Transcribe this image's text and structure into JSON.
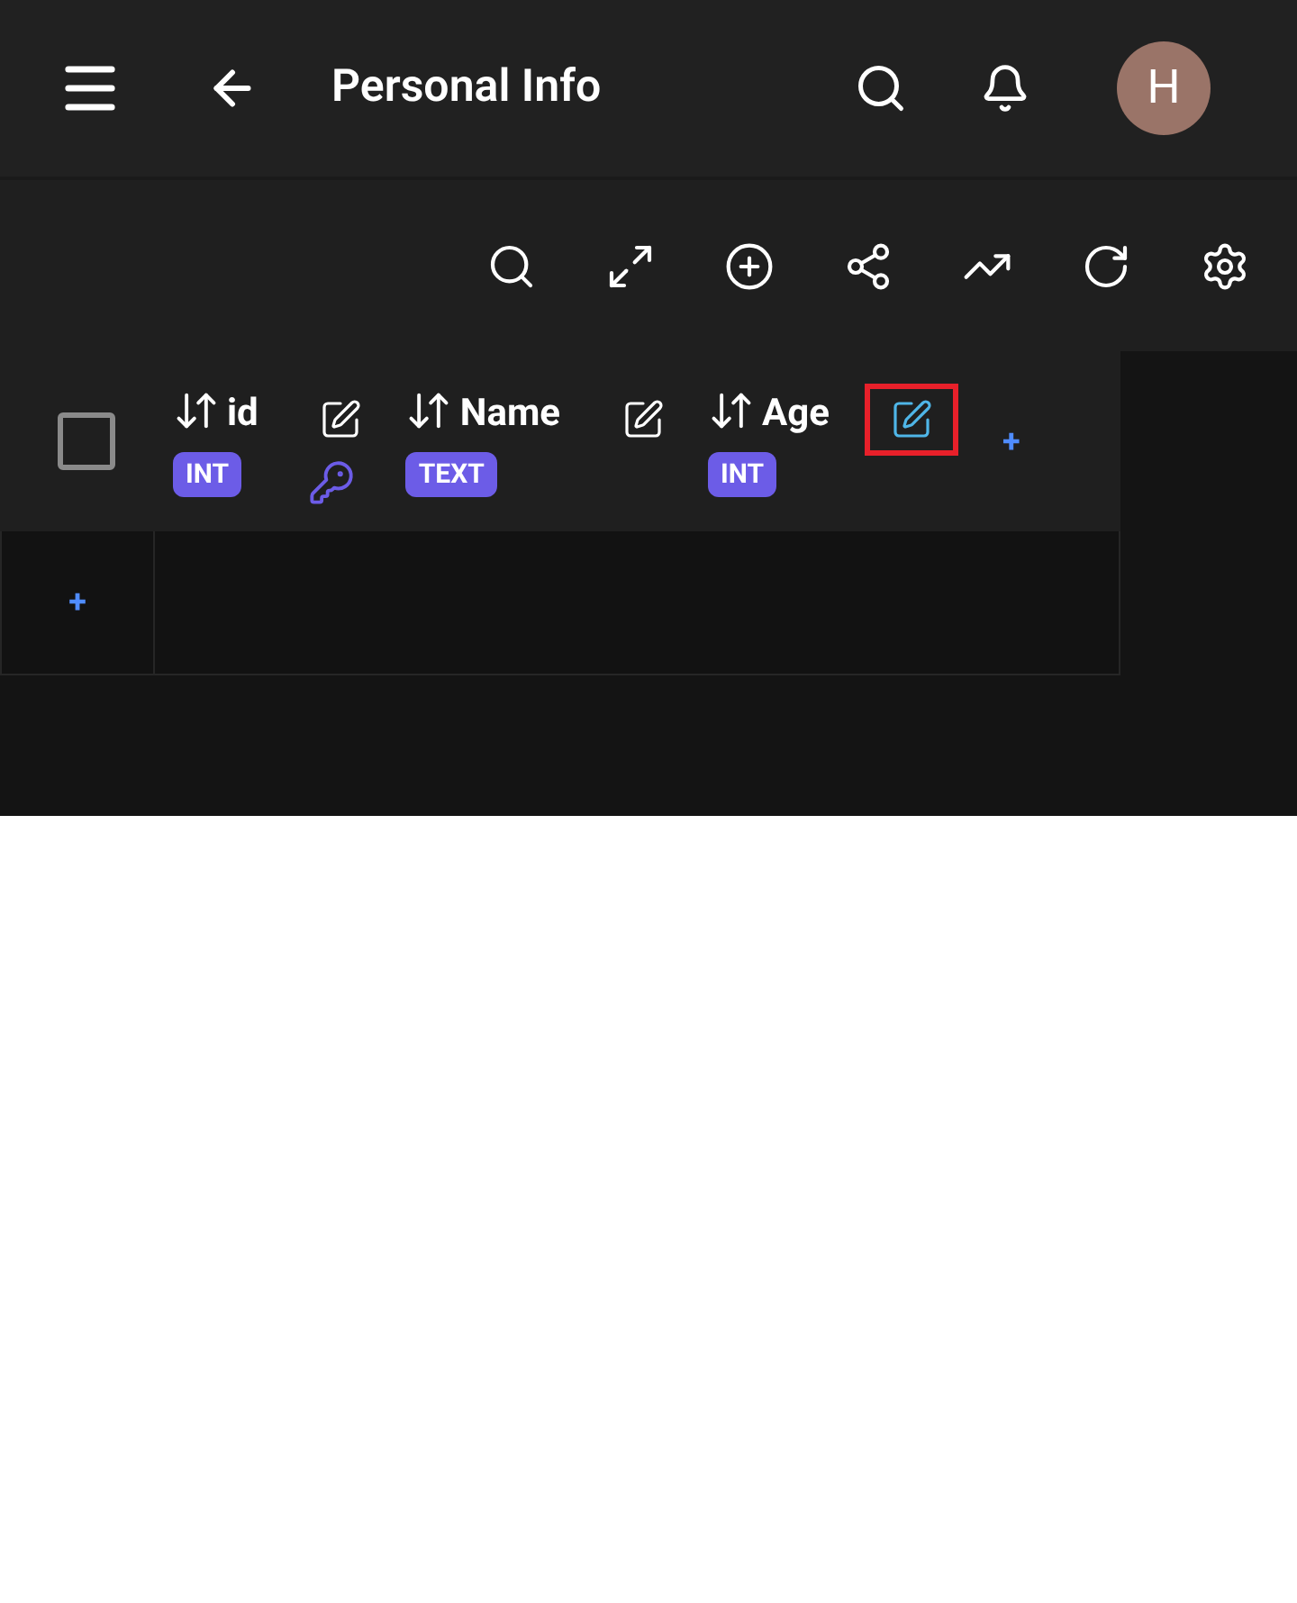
{
  "app_bar": {
    "title": "Personal Info",
    "avatar": "H"
  },
  "table": {
    "select_all": {
      "checked": false
    },
    "columns": [
      {
        "name": "id",
        "type": "INT",
        "primary_key": true,
        "highlighted": false
      },
      {
        "name": "Name",
        "type": "TEXT",
        "primary_key": false,
        "highlighted": false
      },
      {
        "name": "Age",
        "type": "INT",
        "primary_key": false,
        "highlighted": true
      }
    ],
    "add_column": "+",
    "add_row": "+"
  }
}
